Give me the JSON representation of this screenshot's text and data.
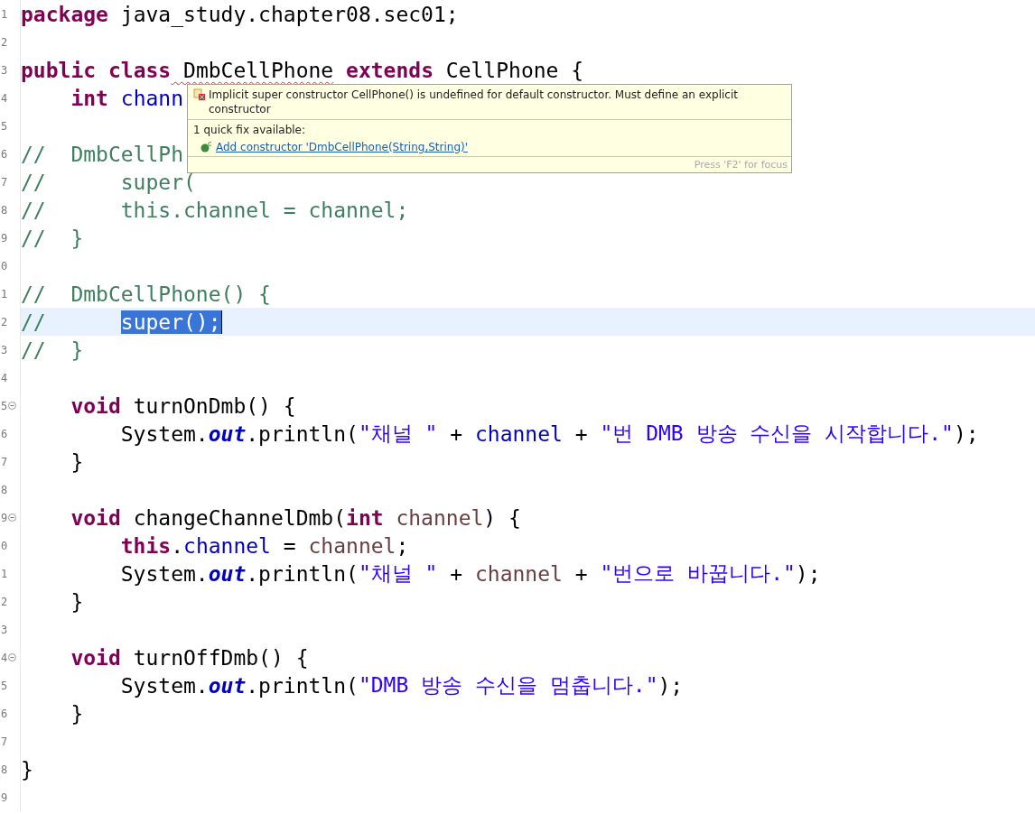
{
  "editor": {
    "lines": [
      {
        "number": "1",
        "fold": false,
        "current": false,
        "tokens": [
          {
            "kind": "keyword",
            "text": "package"
          },
          {
            "kind": "plain",
            "text": " java_study.chapter08.sec01;"
          }
        ]
      },
      {
        "number": "2",
        "fold": false,
        "current": false
      },
      {
        "number": "3",
        "fold": false,
        "current": false,
        "tokens": [
          {
            "kind": "keyword",
            "text": "public"
          },
          {
            "kind": "keyword",
            "text": " class"
          },
          {
            "kind": "error",
            "text": " DmbCellPhone"
          },
          {
            "kind": "keyword",
            "text": " extends"
          },
          {
            "kind": "plain",
            "text": " CellPhone {"
          }
        ]
      },
      {
        "number": "4",
        "fold": false,
        "current": false,
        "tokens": [
          {
            "kind": "keyword",
            "text": "    int"
          },
          {
            "kind": "field",
            "text": " chann"
          }
        ]
      },
      {
        "number": "5",
        "fold": false,
        "current": false
      },
      {
        "number": "6",
        "fold": false,
        "current": false,
        "tokens": [
          {
            "kind": "comment",
            "text": "//  DmbCellPh"
          }
        ]
      },
      {
        "number": "7",
        "fold": false,
        "current": false,
        "tokens": [
          {
            "kind": "comment",
            "text": "//      super("
          }
        ]
      },
      {
        "number": "8",
        "fold": false,
        "current": false,
        "tokens": [
          {
            "kind": "comment",
            "text": "//      this.channel = channel;"
          }
        ]
      },
      {
        "number": "9",
        "fold": false,
        "current": false,
        "tokens": [
          {
            "kind": "comment",
            "text": "//  }"
          }
        ]
      },
      {
        "number": "0",
        "fold": false,
        "current": false
      },
      {
        "number": "1",
        "fold": false,
        "current": false,
        "tokens": [
          {
            "kind": "comment",
            "text": "//  DmbCellPhone() {"
          }
        ]
      },
      {
        "number": "2",
        "fold": false,
        "current": true,
        "tokens": [
          {
            "kind": "comment",
            "text": "//      "
          },
          {
            "kind": "selection",
            "text": "super();"
          }
        ]
      },
      {
        "number": "3",
        "fold": false,
        "current": false,
        "tokens": [
          {
            "kind": "comment",
            "text": "//  }"
          }
        ]
      },
      {
        "number": "4",
        "fold": false,
        "current": false
      },
      {
        "number": "5",
        "fold": true,
        "current": false,
        "tokens": [
          {
            "kind": "keyword",
            "text": "    void"
          },
          {
            "kind": "plain",
            "text": " turnOnDmb() {"
          }
        ]
      },
      {
        "number": "6",
        "fold": false,
        "current": false,
        "tokens": [
          {
            "kind": "plain",
            "text": "        System."
          },
          {
            "kind": "static",
            "text": "out"
          },
          {
            "kind": "plain",
            "text": ".println("
          },
          {
            "kind": "string",
            "text": "\"채널 \""
          },
          {
            "kind": "plain",
            "text": " + "
          },
          {
            "kind": "field",
            "text": "channel"
          },
          {
            "kind": "plain",
            "text": " + "
          },
          {
            "kind": "string",
            "text": "\"번 DMB 방송 수신을 시작합니다.\""
          },
          {
            "kind": "plain",
            "text": ");"
          }
        ]
      },
      {
        "number": "7",
        "fold": false,
        "current": false,
        "tokens": [
          {
            "kind": "plain",
            "text": "    }"
          }
        ]
      },
      {
        "number": "8",
        "fold": false,
        "current": false
      },
      {
        "number": "9",
        "fold": true,
        "current": false,
        "tokens": [
          {
            "kind": "keyword",
            "text": "    void"
          },
          {
            "kind": "plain",
            "text": " changeChannelDmb("
          },
          {
            "kind": "keyword",
            "text": "int"
          },
          {
            "kind": "param",
            "text": " channel"
          },
          {
            "kind": "plain",
            "text": ") {"
          }
        ]
      },
      {
        "number": "0",
        "fold": false,
        "current": false,
        "tokens": [
          {
            "kind": "keyword",
            "text": "        this"
          },
          {
            "kind": "plain",
            "text": "."
          },
          {
            "kind": "field",
            "text": "channel"
          },
          {
            "kind": "plain",
            "text": " = "
          },
          {
            "kind": "param",
            "text": "channel"
          },
          {
            "kind": "plain",
            "text": ";"
          }
        ]
      },
      {
        "number": "1",
        "fold": false,
        "current": false,
        "tokens": [
          {
            "kind": "plain",
            "text": "        System."
          },
          {
            "kind": "static",
            "text": "out"
          },
          {
            "kind": "plain",
            "text": ".println("
          },
          {
            "kind": "string",
            "text": "\"채널 \""
          },
          {
            "kind": "plain",
            "text": " + "
          },
          {
            "kind": "param",
            "text": "channel"
          },
          {
            "kind": "plain",
            "text": " + "
          },
          {
            "kind": "string",
            "text": "\"번으로 바꿉니다.\""
          },
          {
            "kind": "plain",
            "text": ");"
          }
        ]
      },
      {
        "number": "2",
        "fold": false,
        "current": false,
        "tokens": [
          {
            "kind": "plain",
            "text": "    }"
          }
        ]
      },
      {
        "number": "3",
        "fold": false,
        "current": false
      },
      {
        "number": "4",
        "fold": true,
        "current": false,
        "tokens": [
          {
            "kind": "keyword",
            "text": "    void"
          },
          {
            "kind": "plain",
            "text": " turnOffDmb() {"
          }
        ]
      },
      {
        "number": "5",
        "fold": false,
        "current": false,
        "tokens": [
          {
            "kind": "plain",
            "text": "        System."
          },
          {
            "kind": "static",
            "text": "out"
          },
          {
            "kind": "plain",
            "text": ".println("
          },
          {
            "kind": "string",
            "text": "\"DMB 방송 수신을 멈춥니다.\""
          },
          {
            "kind": "plain",
            "text": ");"
          }
        ]
      },
      {
        "number": "6",
        "fold": false,
        "current": false,
        "tokens": [
          {
            "kind": "plain",
            "text": "    }"
          }
        ]
      },
      {
        "number": "7",
        "fold": false,
        "current": false
      },
      {
        "number": "8",
        "fold": false,
        "current": false,
        "tokens": [
          {
            "kind": "plain",
            "text": "}"
          }
        ]
      },
      {
        "number": "9",
        "fold": false,
        "current": false
      }
    ]
  },
  "hover": {
    "message": "Implicit super constructor CellPhone() is undefined for default constructor. Must define an explicit constructor",
    "fixes_title": "1 quick fix available:",
    "fixes": [
      "Add constructor 'DmbCellPhone(String,String)'"
    ],
    "footer": "Press 'F2' for focus"
  }
}
